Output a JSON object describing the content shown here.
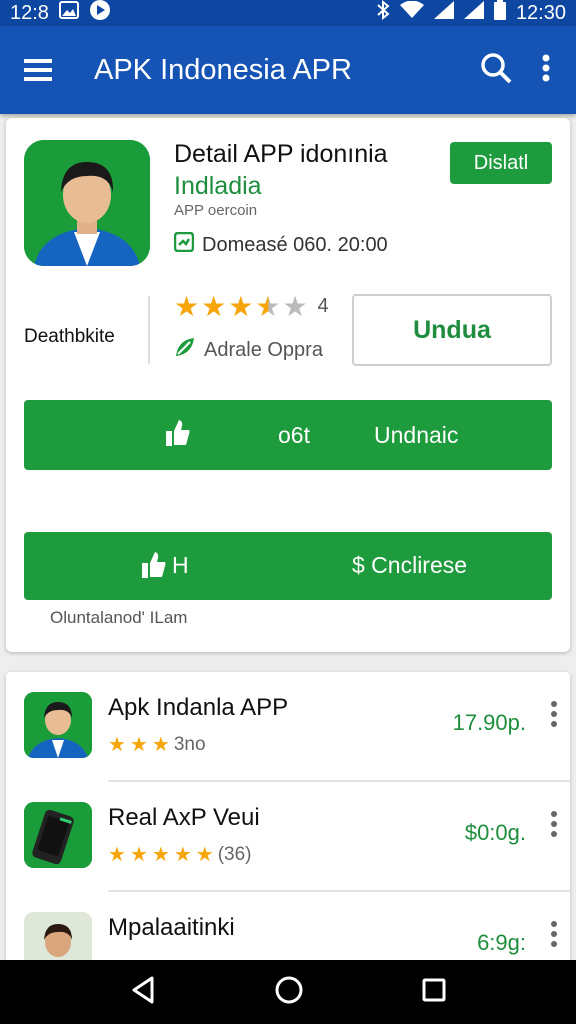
{
  "status_bar": {
    "time_left": "12:8",
    "time_right": "12:30",
    "icons": [
      "image-icon",
      "play-icon",
      "bluetooth-icon",
      "wifi-icon",
      "signal-icon",
      "signal-icon",
      "battery-icon"
    ]
  },
  "app_bar": {
    "title": "APK Indonesia APR",
    "icons": [
      "menu-icon",
      "search-icon",
      "more-vert-icon"
    ]
  },
  "detail": {
    "title": "Detail APP idonınia",
    "subtitle": "Indladia",
    "version": "APP oercoin",
    "date": "Domeasé 060. 20:00",
    "tag_button": "Dislatl",
    "description_label": "Deathbkite",
    "rating_value": "4",
    "rating_stars": 3.5,
    "developer": "Adrale Oppra",
    "outline_button": "Undua"
  },
  "buttons": {
    "primary_a": "o6t",
    "primary_b": "Undnaic",
    "secondary_a": "H",
    "secondary_b": "$ Cnclirese",
    "footnote": "Oluntalanod' ILam"
  },
  "list": [
    {
      "name": "Apk Indanla APP",
      "rating": "3no",
      "stars": 3,
      "price": "17.90p."
    },
    {
      "name": "Real AxP Veui",
      "rating": "(36)",
      "stars": 5,
      "price": "$0:0g."
    },
    {
      "name": "Mpalaaitinki",
      "rating": "",
      "stars": 0,
      "price": "6:9g:"
    }
  ],
  "nav_bar": {
    "icons": [
      "back-icon",
      "home-icon",
      "recents-icon"
    ]
  },
  "colors": {
    "status_bar": "#0d47a1",
    "app_bar": "#1554b5",
    "accent_green": "#1e9b3d",
    "star": "#f6a50a"
  }
}
